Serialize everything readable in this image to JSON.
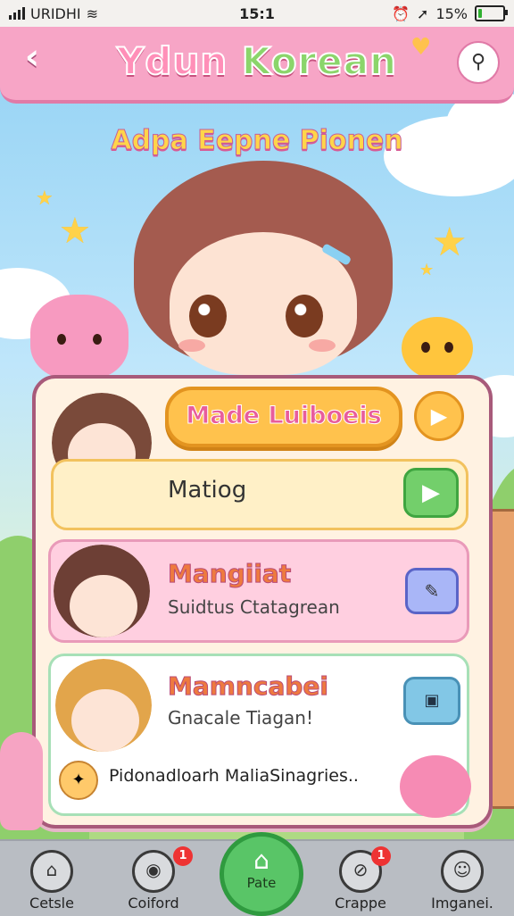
{
  "status": {
    "carrier": "URIDHI",
    "time": "15:1",
    "battery": "15%",
    "battery_level": 0.15
  },
  "header": {
    "title_part1": "Ydun ",
    "title_part2": "Korean"
  },
  "subtitle": "Adpa Eepne Pionen",
  "panel": {
    "main_button": "Made Luiboeis",
    "row1": {
      "label": "Matiog"
    },
    "row2": {
      "title": "Mangiiat",
      "subtitle": "Suidtus Ctatagrean"
    },
    "row3": {
      "title": "Mamncabei",
      "subtitle": "Gnacale Tiagan!",
      "footer": "Pidonadloarh MaliaSinagries.."
    }
  },
  "nav": {
    "items": [
      {
        "label": "Cetsle",
        "icon": "home-icon"
      },
      {
        "label": "Coiford",
        "icon": "camera-icon",
        "badge": "1"
      },
      {
        "label": "Pate",
        "icon": "house-icon"
      },
      {
        "label": "Crappe",
        "icon": "clip-icon",
        "badge": "1"
      },
      {
        "label": "Imganei.",
        "icon": "profile-icon"
      }
    ]
  },
  "colors": {
    "header": "#f7a5c6",
    "accent_orange": "#ffc24d",
    "accent_green": "#59c567"
  }
}
